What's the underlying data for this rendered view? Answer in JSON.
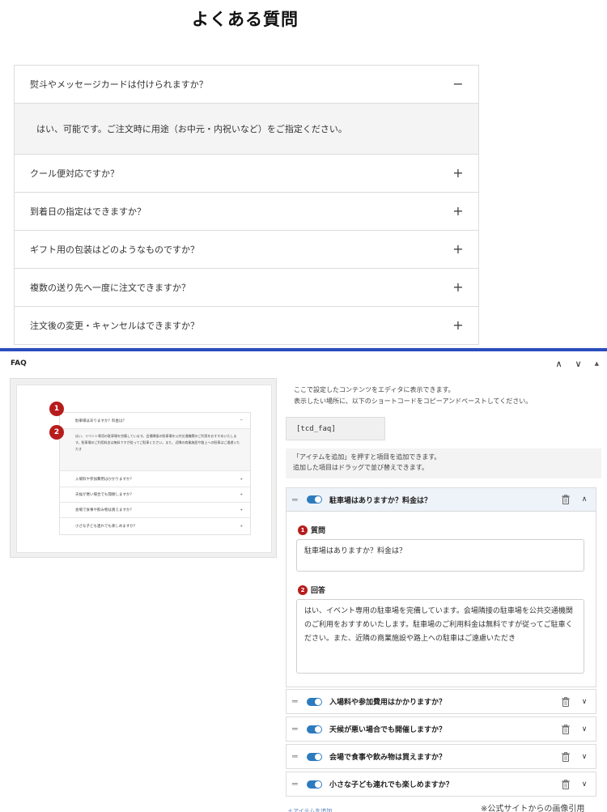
{
  "faq": {
    "title": "よくある質問",
    "items": [
      {
        "question": "熨斗やメッセージカードは付けられますか？",
        "open": true,
        "answer": "はい、可能です。ご注文時に用途（お中元・内祝いなど）をご指定ください。"
      },
      {
        "question": "クール便対応ですか？",
        "open": false
      },
      {
        "question": "到着日の指定はできますか？",
        "open": false
      },
      {
        "question": "ギフト用の包装はどのようなものですか？",
        "open": false
      },
      {
        "question": "複数の送り先へ一度に注文できますか？",
        "open": false
      },
      {
        "question": "注文後の変更・キャンセルはできますか？",
        "open": false
      }
    ],
    "icon_minus": "−",
    "icon_plus": "+"
  },
  "editor": {
    "panel_title": "FAQ",
    "controls": {
      "up": "∧",
      "down": "∨",
      "collapse": "▲"
    },
    "preview": {
      "rows": [
        "駐車場はありますか？料金は？",
        "入場料や参加費用はかかりますか？",
        "天候が悪い場合でも開催しますか？",
        "会場で食事や飲み物は買えますか？",
        "小さな子ども連れでも楽しめますか？"
      ],
      "answer": "はい、イベント専用の駐車場を完備しています。会場隣接の駐車場を公共交通機関のご利用をおすすめいたします。駐車場のご利用料金は無料ですが従ってご駐車ください。また、近隣の商業施設や路上への駐車はご遠慮いただき",
      "badges": [
        "1",
        "2"
      ]
    },
    "description": "ここで設定したコンテンツをエディタに表示できます。\n表示したい場所に、以下のショートコードをコピーアンドペーストしてください。",
    "shortcode": "[tcd_faq]",
    "add_hint": "「アイテムを追加」を押すと項目を追加できます。\n追加した項目はドラッグで並び替えできます。",
    "items": [
      {
        "label": "駐車場はありますか？料金は？",
        "enabled": true,
        "open": true
      },
      {
        "label": "入場料や参加費用はかかりますか？",
        "enabled": true,
        "open": false
      },
      {
        "label": "天候が悪い場合でも開催しますか？",
        "enabled": true,
        "open": false
      },
      {
        "label": "会場で食事や飲み物は買えますか？",
        "enabled": true,
        "open": false
      },
      {
        "label": "小さな子ども連れでも楽しめますか？",
        "enabled": true,
        "open": false
      }
    ],
    "fields": {
      "question_label": "質問",
      "question_value": "駐車場はありますか？料金は？",
      "answer_label": "回答",
      "answer_value": "はい、イベント専用の駐車場を完備しています。会場隣接の駐車場を公共交通機関のご利用をおすすめいたします。駐車場のご利用料金は無料ですが従ってご駐車ください。また、近隣の商業施設や路上への駐車はご遠慮いただき",
      "badge1": "1",
      "badge2": "2"
    },
    "toggle_state": "on",
    "chevron_open": "∧",
    "chevron_closed": "∨",
    "drag_glyph": "═",
    "cut_text": "＋アイテムを追加"
  },
  "note": "※公式サイトからの画像引用",
  "colors": {
    "accent": "#2c4dbf",
    "toggle": "#2d7bbf",
    "badge": "#b71c1c"
  }
}
